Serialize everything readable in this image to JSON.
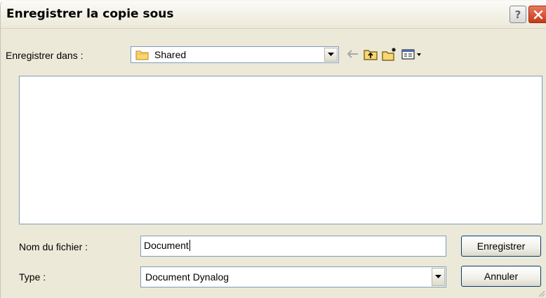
{
  "dialog": {
    "title": "Enregistrer la copie sous"
  },
  "save_in": {
    "label": "Enregistrer dans :",
    "value": "Shared"
  },
  "filename": {
    "label": "Nom du fichier :",
    "value": "Document"
  },
  "type": {
    "label": "Type :",
    "value": "Document Dynalog"
  },
  "buttons": {
    "save": "Enregistrer",
    "cancel": "Annuler",
    "help": "?"
  },
  "icons": {
    "folder": "folder-icon",
    "back": "back-arrow-icon",
    "up": "up-folder-icon",
    "new_folder": "new-folder-icon",
    "view_menu": "view-menu-icon"
  },
  "colors": {
    "dialog_bg": "#ece9d8",
    "field_border": "#7f9db9",
    "button_border": "#003c74",
    "close_red": "#c6381a"
  }
}
